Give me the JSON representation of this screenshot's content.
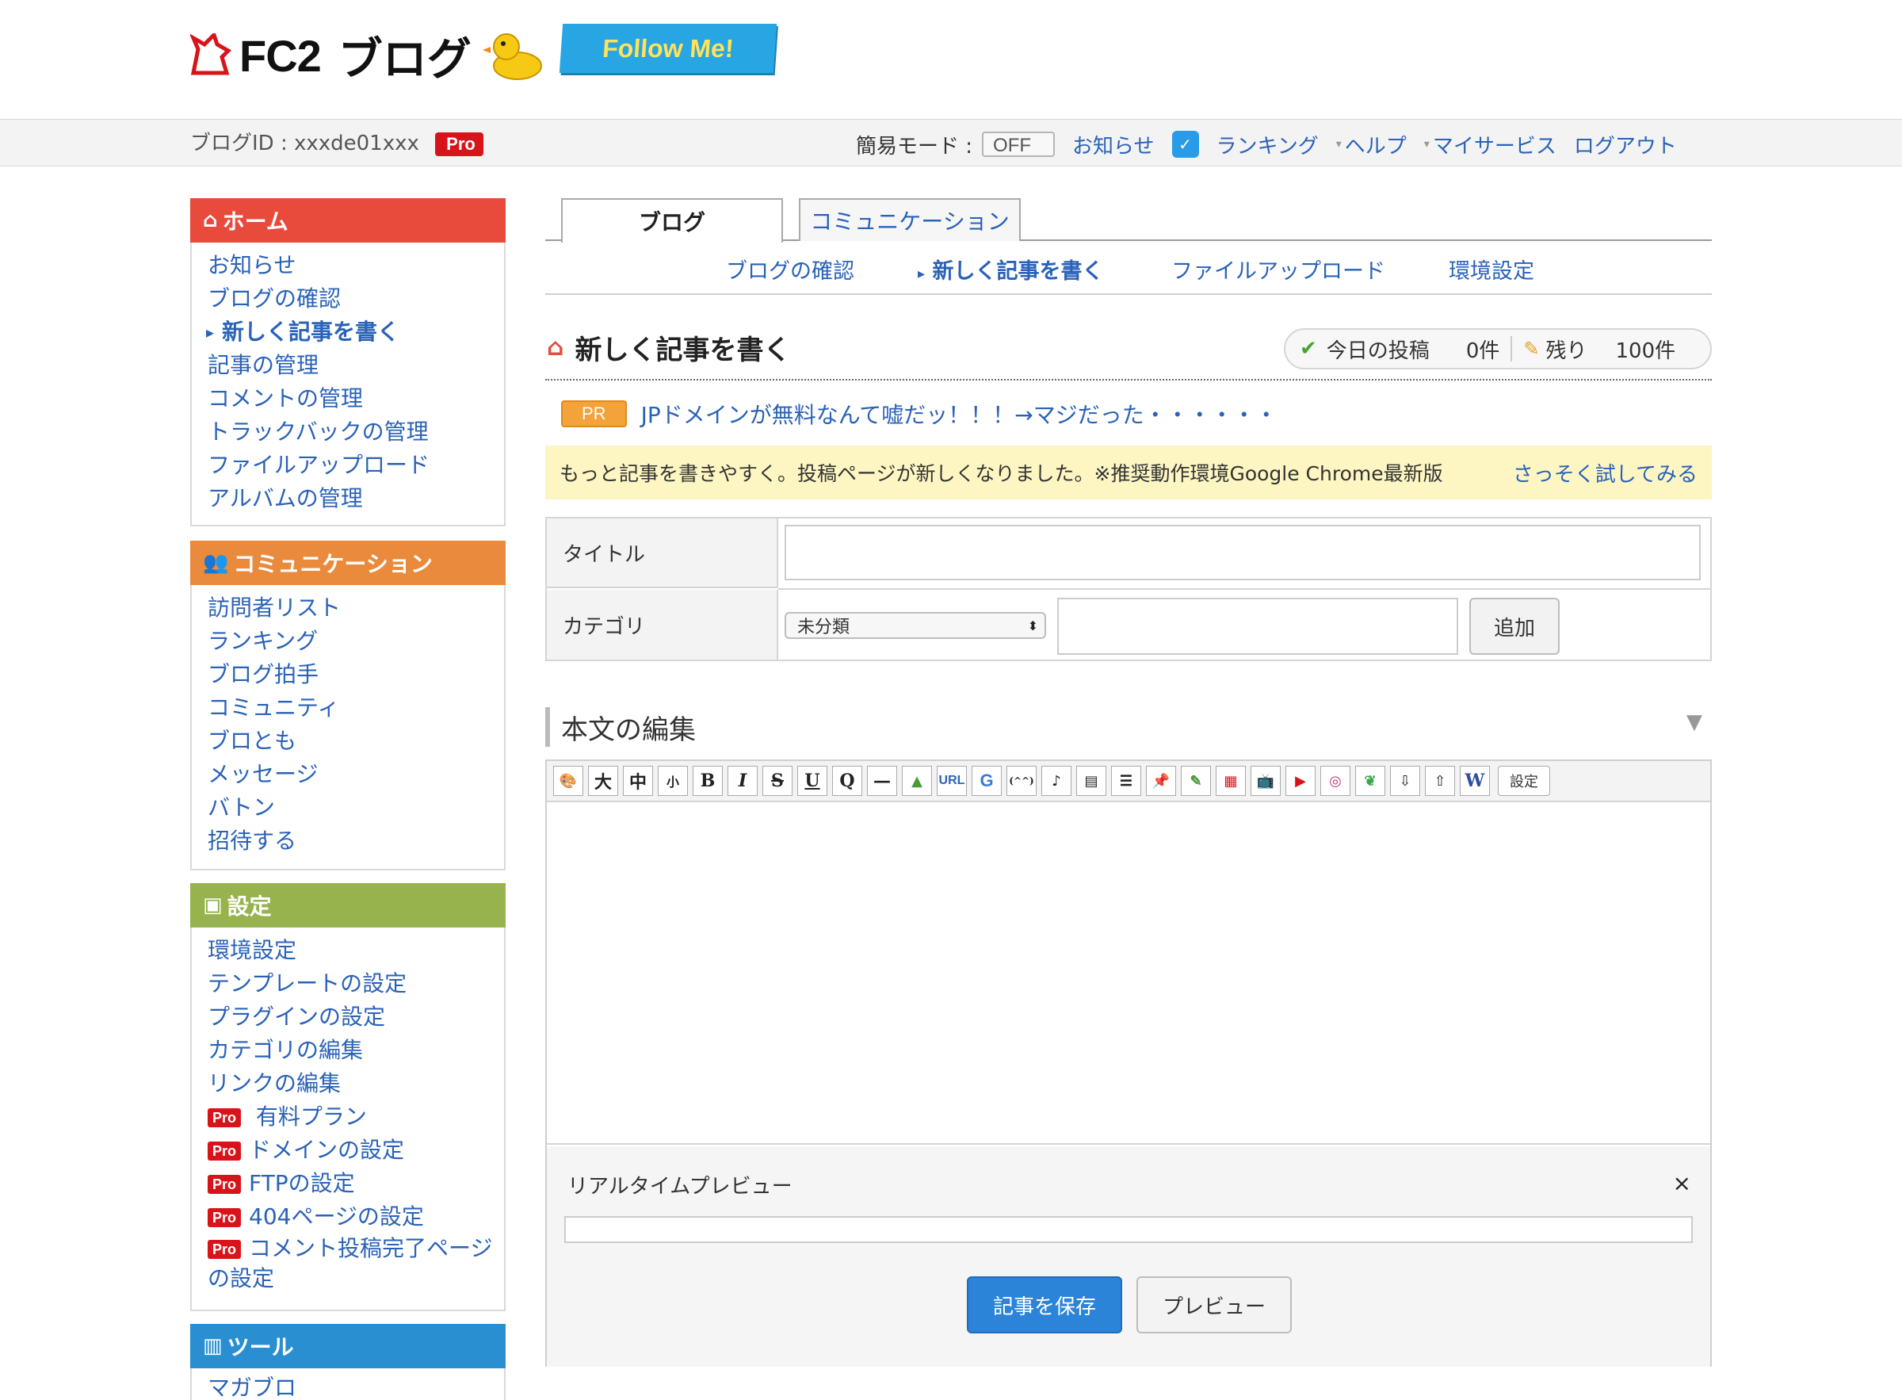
{
  "header": {
    "logo_text": "FC2",
    "logo_blog": "ブログ",
    "follow_label": "Follow Me!"
  },
  "topbar": {
    "blog_id_label": "ブログID : xxxde01xxx",
    "pro_badge": "Pro",
    "simple_mode_label": "簡易モード :",
    "simple_mode_value": "OFF",
    "links": [
      "お知らせ",
      "ランキング",
      "ヘルプ",
      "マイサービス",
      "ログアウト"
    ]
  },
  "sidebar": {
    "home": {
      "title": "ホーム",
      "items": [
        "お知らせ",
        "ブログの確認",
        "新しく記事を書く",
        "記事の管理",
        "コメントの管理",
        "トラックバックの管理",
        "ファイルアップロード",
        "アルバムの管理"
      ]
    },
    "communication": {
      "title": "コミュニケーション",
      "items": [
        "訪問者リスト",
        "ランキング",
        "ブログ拍手",
        "コミュニティ",
        "ブロとも",
        "メッセージ",
        "バトン",
        "招待する"
      ]
    },
    "settings": {
      "title": "設定",
      "items": [
        "環境設定",
        "テンプレートの設定",
        "プラグインの設定",
        "カテゴリの編集",
        "リンクの編集"
      ],
      "pro_badge": "Pro",
      "pro_items": [
        "有料プラン",
        "ドメインの設定",
        "FTPの設定",
        "404ページの設定",
        "コメント投稿完了ページ",
        "の設定"
      ]
    },
    "tools": {
      "title": "ツール",
      "items": [
        "マガブロ"
      ]
    }
  },
  "tabs": [
    "ブログ",
    "コミュニケーション"
  ],
  "subnav": [
    "ブログの確認",
    "新しく記事を書く",
    "ファイルアップロード",
    "環境設定"
  ],
  "page": {
    "title": "新しく記事を書く",
    "stats_today_label": "今日の投稿",
    "stats_today_value": "0件",
    "stats_remaining_label": "残り",
    "stats_remaining_value": "100件"
  },
  "pr": {
    "badge": "PR",
    "text": "JPドメインが無料なんて嘘だッ！！！→マジだった・・・・・・"
  },
  "notice": {
    "text": "もっと記事を書きやすく。投稿ページが新しくなりました。※推奨動作環境Google Chrome最新版",
    "link": "さっそく試してみる"
  },
  "form": {
    "title_label": "タイトル",
    "title_value": "",
    "category_label": "カテゴリ",
    "category_selected": "未分類",
    "category_new_value": "",
    "add_button": "追加"
  },
  "editor": {
    "heading": "本文の編集",
    "toolbar": [
      "大",
      "中",
      "小",
      "B",
      "I",
      "S",
      "U",
      "Q",
      "—",
      "URL",
      "G",
      "(^^)",
      "W"
    ],
    "settings_button": "設定",
    "body_value": "",
    "preview_label": "リアルタイムプレビュー",
    "close_symbol": "×",
    "save_button": "記事を保存",
    "preview_button": "プレビュー"
  }
}
